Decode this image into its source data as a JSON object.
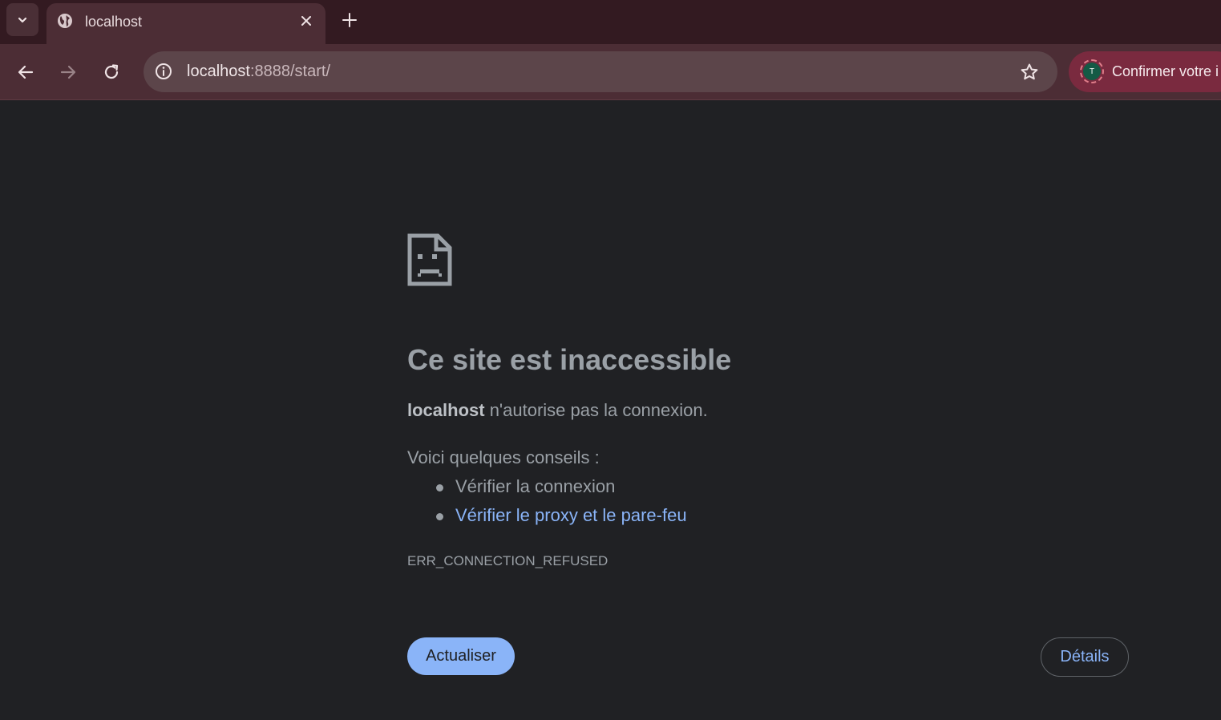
{
  "tabs": [
    {
      "title": "localhost",
      "favicon": "globe-icon",
      "active": true
    }
  ],
  "toolbar": {
    "url_host": "localhost",
    "url_rest": ":8888/start/",
    "profile_label": "Confirmer votre i",
    "profile_initial": "T"
  },
  "error": {
    "headline": "Ce site est inaccessible",
    "summary_host": "localhost",
    "summary_text": " n'autorise pas la connexion.",
    "tips_title": "Voici quelques conseils :",
    "tips": [
      {
        "label": "Vérifier la connexion",
        "is_link": false
      },
      {
        "label": "Vérifier le proxy et le pare-feu",
        "is_link": true
      }
    ],
    "code": "ERR_CONNECTION_REFUSED",
    "reload_label": "Actualiser",
    "details_label": "Détails"
  },
  "colors": {
    "tabstrip": "#331a21",
    "toolbar": "#4c2d35",
    "page_bg": "#202124",
    "accent_blue": "#8ab4f8",
    "text_gray": "#9aa0a6"
  }
}
